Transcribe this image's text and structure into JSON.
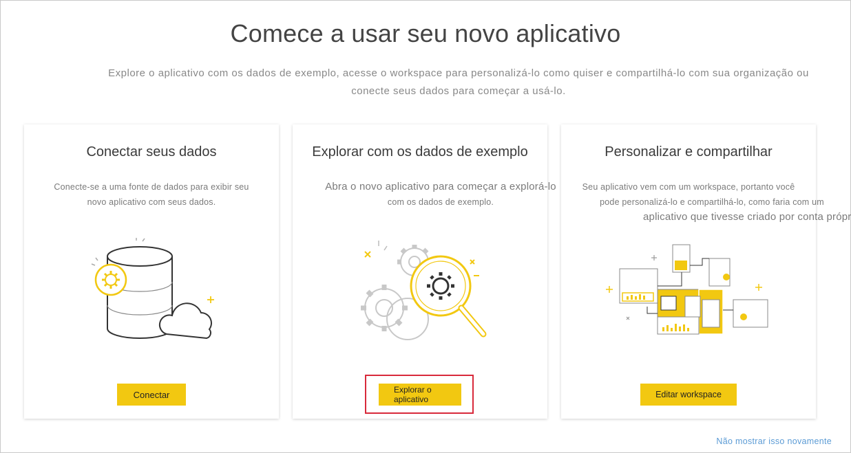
{
  "header": {
    "title": "Comece a usar seu novo aplicativo",
    "subtitle_line1": "Explore o aplicativo com os dados de exemplo, acesse o workspace para personalizá-lo como quiser e compartilhá-lo com sua organização ou",
    "subtitle_line2": "conecte seus dados para começar a usá-lo."
  },
  "cards": [
    {
      "title": "Conectar seus dados",
      "desc_lines": [
        "Conecte-se a uma fonte de dados para exibir seu",
        "novo aplicativo com seus dados."
      ],
      "button": "Conectar",
      "illustration": "database-cloud-icon"
    },
    {
      "title": "Explorar com os dados de exemplo",
      "desc_lines": [
        "Abra o novo aplicativo para começar a explorá-lo",
        "com os dados de exemplo."
      ],
      "button": "Explorar o aplicativo",
      "illustration": "gears-magnifier-icon"
    },
    {
      "title": "Personalizar e compartilhar",
      "desc_lines": [
        "Seu aplicativo vem com um workspace, portanto você",
        "pode personalizá-lo e compartilhá-lo, como faria com um",
        "aplicativo que tivesse criado por conta própri"
      ],
      "button": "Editar workspace",
      "illustration": "dashboard-share-icon"
    }
  ],
  "footer": {
    "link": "Não mostrar isso novamente"
  },
  "colors": {
    "accent": "#F2C811",
    "highlight": "#D8293A",
    "link": "#5B9BD5"
  }
}
